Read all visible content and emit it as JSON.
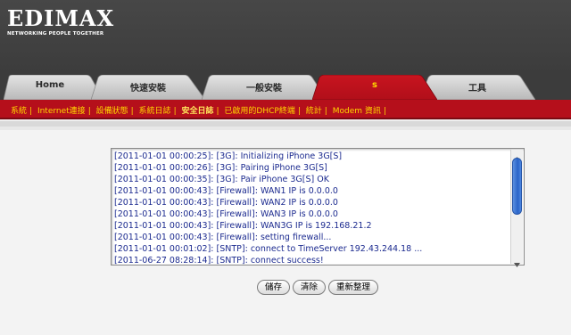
{
  "brand": {
    "logo": "EDIMAX",
    "tagline": "NETWORKING PEOPLE TOGETHER"
  },
  "tabs": [
    {
      "label": "Home",
      "active": false
    },
    {
      "label": "快速安裝",
      "active": false
    },
    {
      "label": "一般安裝",
      "active": false
    },
    {
      "label": "s",
      "active": true
    },
    {
      "label": "工具",
      "active": false
    }
  ],
  "submenu": [
    {
      "label": "系統",
      "active": false
    },
    {
      "label": "Internet連接",
      "active": false
    },
    {
      "label": "設備狀態",
      "active": false
    },
    {
      "label": "系統日誌",
      "active": false
    },
    {
      "label": "安全日誌",
      "active": true
    },
    {
      "label": "已啟用的DHCP終端",
      "active": false
    },
    {
      "label": "統計",
      "active": false
    },
    {
      "label": "Modem 資訊",
      "active": false
    }
  ],
  "log": {
    "lines": [
      "[2011-01-01 00:00:25]: [3G]: Initializing iPhone 3G[S]",
      "[2011-01-01 00:00:26]: [3G]: Pairing iPhone 3G[S]",
      "[2011-01-01 00:00:35]: [3G]: Pair iPhone 3G[S] OK",
      "[2011-01-01 00:00:43]: [Firewall]: WAN1 IP is 0.0.0.0",
      "[2011-01-01 00:00:43]: [Firewall]: WAN2 IP is 0.0.0.0",
      "[2011-01-01 00:00:43]: [Firewall]: WAN3 IP is 0.0.0.0",
      "[2011-01-01 00:00:43]: [Firewall]: WAN3G IP is 192.168.21.2",
      "[2011-01-01 00:00:43]: [Firewall]: setting firewall...",
      "[2011-01-01 00:01:02]: [SNTP]: connect to TimeServer 192.43.244.18 ...",
      "[2011-06-27 08:28:14]: [SNTP]: connect success!"
    ]
  },
  "buttons": {
    "save": "儲存",
    "clear": "清除",
    "refresh": "重新整理"
  }
}
